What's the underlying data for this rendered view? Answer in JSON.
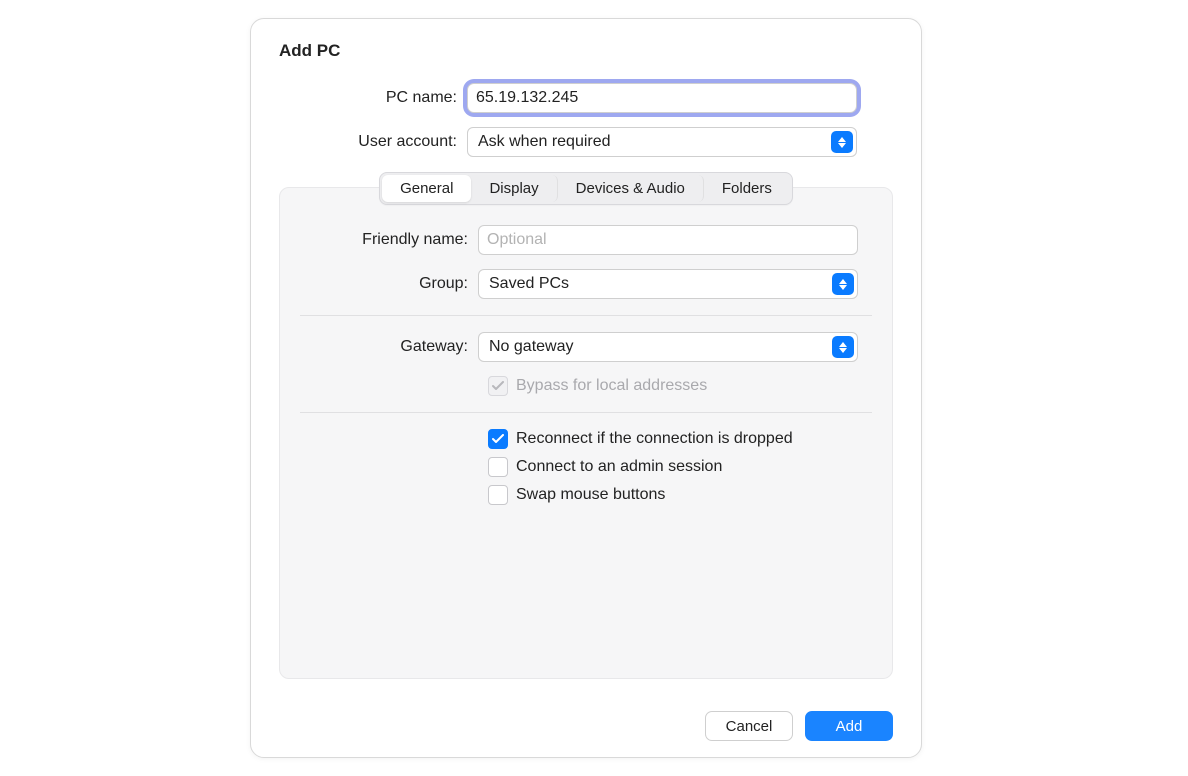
{
  "title": "Add PC",
  "fields": {
    "pc_name": {
      "label": "PC name:",
      "value": "65.19.132.245"
    },
    "user_account": {
      "label": "User account:",
      "value": "Ask when required"
    }
  },
  "tabs": {
    "general": "General",
    "display": "Display",
    "devices": "Devices & Audio",
    "folders": "Folders"
  },
  "general": {
    "friendly_name": {
      "label": "Friendly name:",
      "placeholder": "Optional",
      "value": ""
    },
    "group": {
      "label": "Group:",
      "value": "Saved PCs"
    },
    "gateway": {
      "label": "Gateway:",
      "value": "No gateway"
    },
    "bypass": {
      "label": "Bypass for local addresses",
      "checked": true,
      "disabled": true
    },
    "reconnect": {
      "label": "Reconnect if the connection is dropped",
      "checked": true
    },
    "admin_session": {
      "label": "Connect to an admin session",
      "checked": false
    },
    "swap_mouse": {
      "label": "Swap mouse buttons",
      "checked": false
    }
  },
  "buttons": {
    "cancel": "Cancel",
    "add": "Add"
  }
}
